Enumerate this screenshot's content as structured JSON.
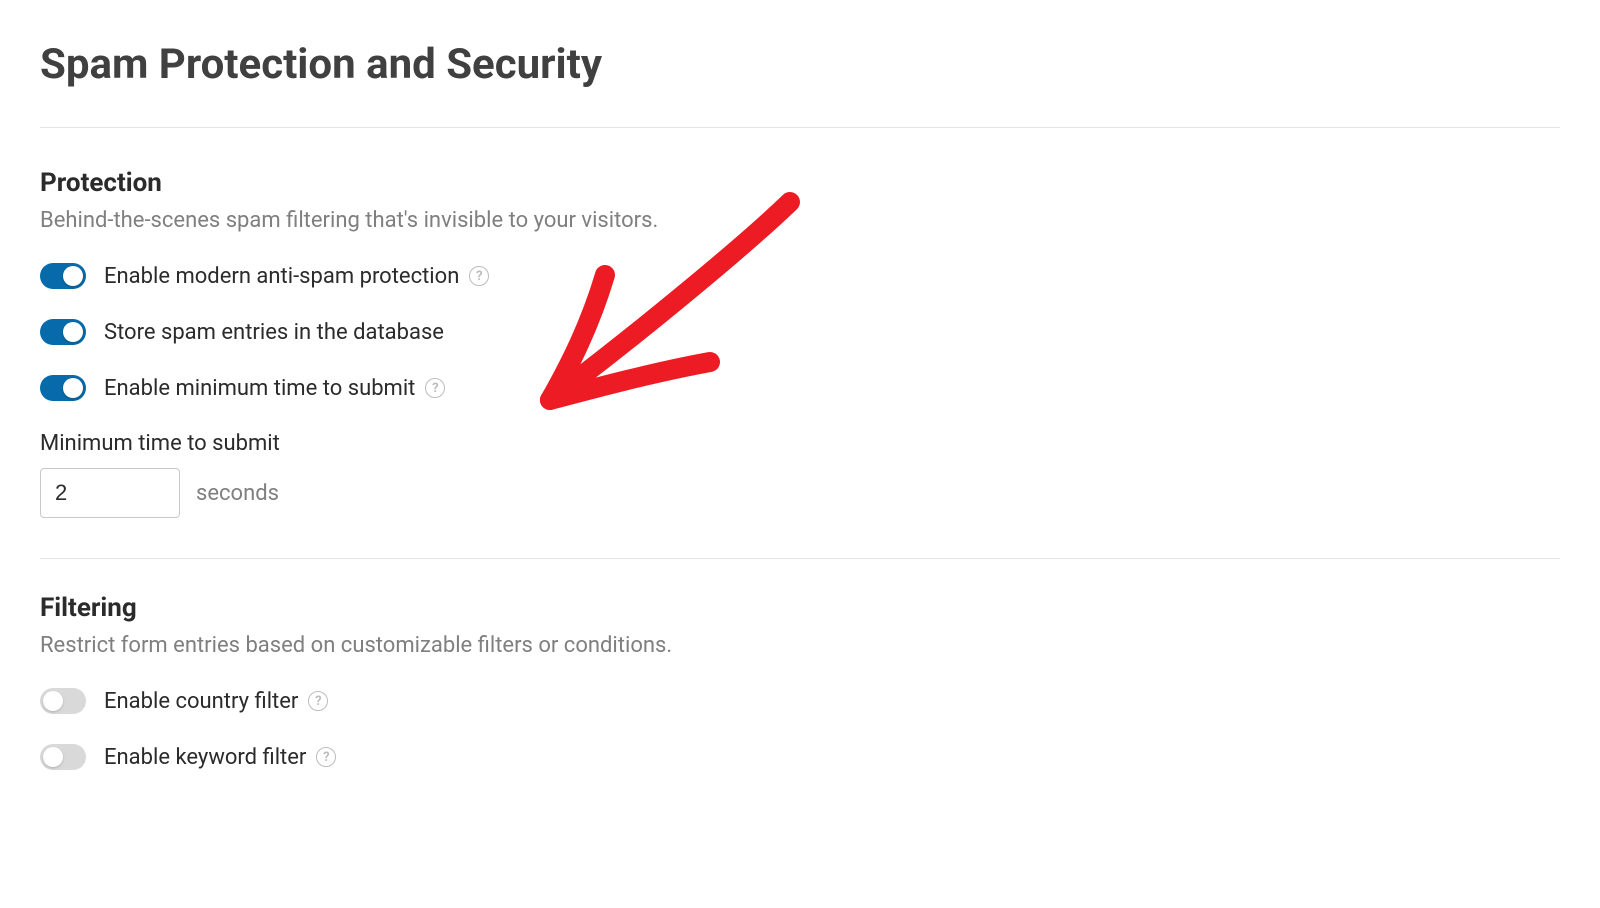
{
  "page": {
    "title": "Spam Protection and Security"
  },
  "protection": {
    "title": "Protection",
    "description": "Behind-the-scenes spam filtering that's invisible to your visitors.",
    "toggles": {
      "anti_spam": {
        "label": "Enable modern anti-spam protection",
        "on": true,
        "help": true
      },
      "store_spam": {
        "label": "Store spam entries in the database",
        "on": true,
        "help": false
      },
      "min_time": {
        "label": "Enable minimum time to submit",
        "on": true,
        "help": true
      }
    },
    "min_time_field": {
      "label": "Minimum time to submit",
      "value": "2",
      "unit": "seconds"
    }
  },
  "filtering": {
    "title": "Filtering",
    "description": "Restrict form entries based on customizable filters or conditions.",
    "toggles": {
      "country": {
        "label": "Enable country filter",
        "on": false,
        "help": true
      },
      "keyword": {
        "label": "Enable keyword filter",
        "on": false,
        "help": true
      }
    }
  }
}
